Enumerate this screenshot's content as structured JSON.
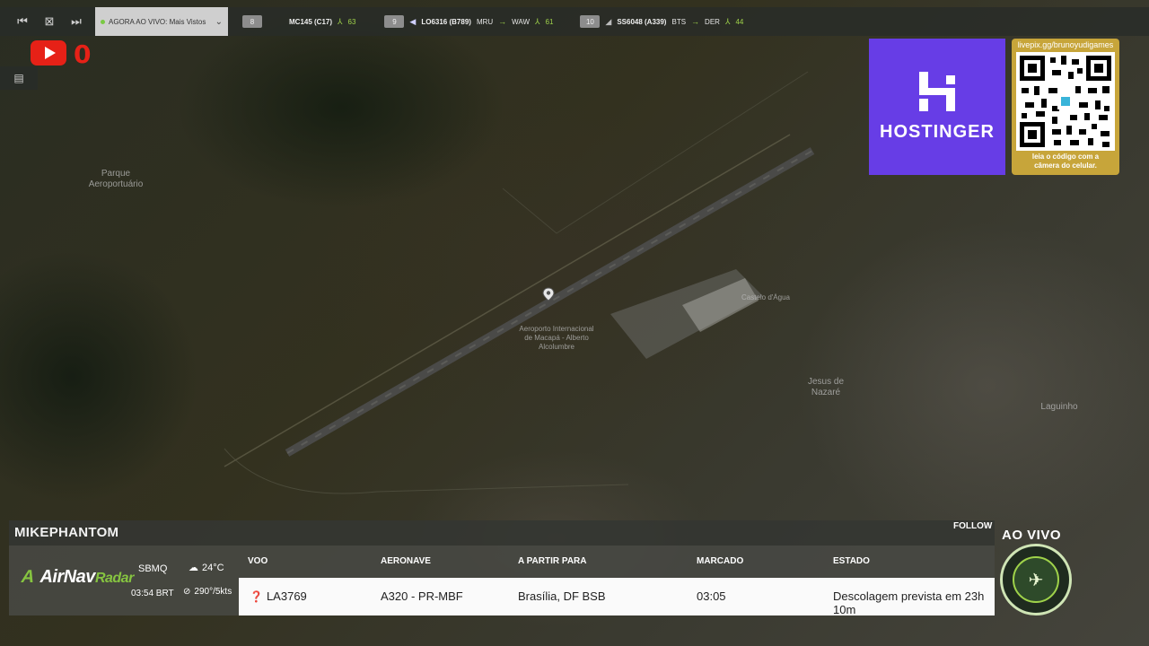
{
  "toolbar": {
    "live_label": "AGORA AO VIVO: Mais Vistos",
    "flights": [
      {
        "num": "8",
        "callsign": "MC145 (C17)",
        "route": "",
        "score": "63"
      },
      {
        "num": "9",
        "callsign": "LO6316 (B789)",
        "route_from": "MRU",
        "route_to": "WAW",
        "score": "61"
      },
      {
        "num": "10",
        "callsign": "SS6048 (A339)",
        "route_from": "BTS",
        "route_to": "DER",
        "score": "44"
      }
    ]
  },
  "youtube": {
    "count": "0"
  },
  "map_labels": {
    "park": "Parque\nAeroportuário",
    "airport": "Aeroporto Internacional\nde Macapá - Alberto\nAlcolumbre",
    "jesus": "Jesus de\nNazaré",
    "laguinho": "Laguinho",
    "castelo": "Castelo d'Água"
  },
  "ad": {
    "brand": "HOSTINGER",
    "url": "livepix.gg/brunoyudigames",
    "caption": "leia o código com a\ncâmera do celular."
  },
  "panel": {
    "streamer": "MIKEPHANTOM",
    "follow": "FOLLOW",
    "airnav_mark": "A",
    "airnav_brand": "AirNav",
    "airnav_radar": "Radar",
    "airport_code": "SBMQ",
    "local_time": "03:54 BRT",
    "temperature": "24°C",
    "wind": "290°/5kts",
    "headers": {
      "voo": "VOO",
      "aeronave": "AERONAVE",
      "destino": "A PARTIR PARA",
      "marcado": "MARCADO",
      "estado": "ESTADO"
    },
    "row": {
      "voo": "LA3769",
      "aeronave": "A320 - PR-MBF",
      "destino": "Brasília, DF BSB",
      "marcado": "03:05",
      "estado": "Descolagem prevista em 23h 10m"
    }
  },
  "badge": {
    "live": "AO VIVO"
  }
}
